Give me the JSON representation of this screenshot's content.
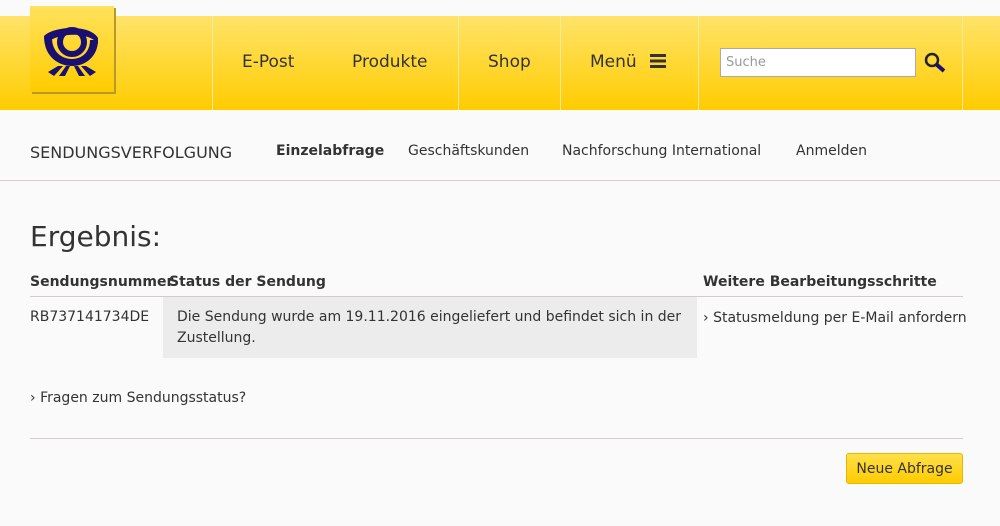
{
  "header": {
    "nav": [
      "E-Post",
      "Produkte",
      "Shop",
      "Menü"
    ],
    "search_placeholder": "Suche"
  },
  "subnav": {
    "title": "SENDUNGSVERFOLGUNG",
    "items": [
      "Einzelabfrage",
      "Geschäftskunden",
      "Nachforschung International",
      "Anmelden"
    ]
  },
  "main": {
    "heading": "Ergebnis:",
    "columns": [
      "Sendungsnummer",
      "Status der Sendung",
      "Weitere Bearbeitungsschritte"
    ],
    "row": {
      "number": "RB737141734DE",
      "status": "Die Sendung wurde am 19.11.2016 eingeliefert und befindet sich in der Zustellung.",
      "action": "Statusmeldung per E-Mail anfordern"
    },
    "faq_link": "Fragen zum Sendungsstatus?",
    "new_query": "Neue Abfrage"
  },
  "colors": {
    "brand_yellow": "#ffcc00",
    "logo_blue": "#1a1070"
  }
}
